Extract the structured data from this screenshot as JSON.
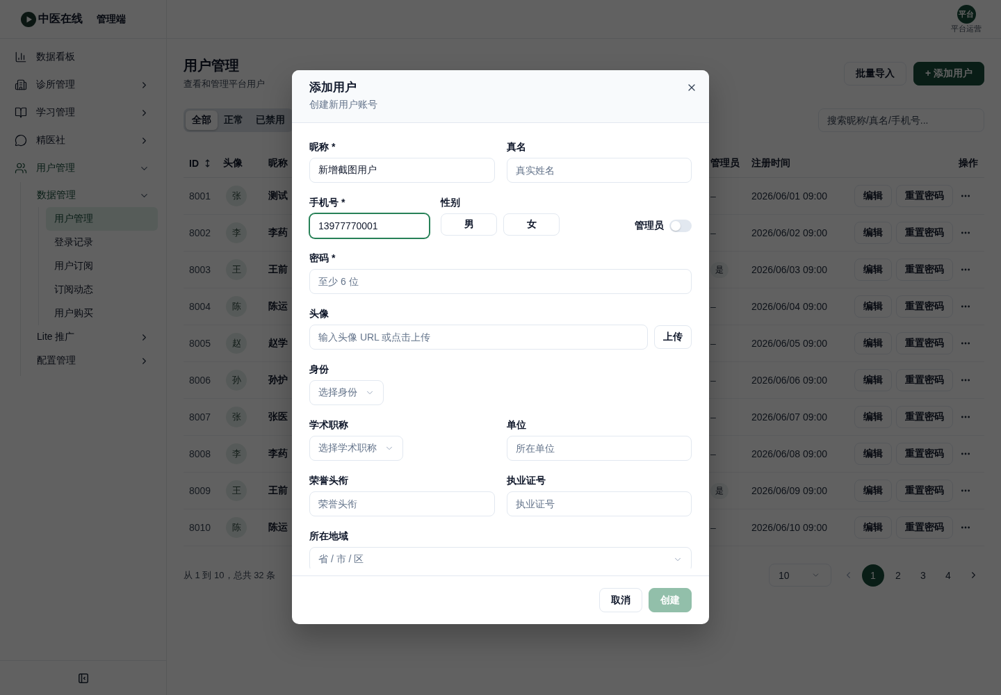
{
  "sidebar": {
    "brand": {
      "name": "中医在线",
      "tag": "管理端"
    },
    "nav": [
      {
        "kind": "link",
        "label": "数据看板",
        "selected": false
      },
      {
        "kind": "group",
        "label": "诊所管理",
        "expanded": false,
        "selected": false
      },
      {
        "kind": "group",
        "label": "学习管理",
        "expanded": false,
        "selected": false
      },
      {
        "kind": "group",
        "label": "精医社",
        "expanded": false,
        "selected": false
      },
      {
        "kind": "group",
        "label": "用户管理",
        "expanded": true,
        "selected": true,
        "children": [
          {
            "kind": "group",
            "label": "数据管理",
            "expanded": true,
            "selected": true,
            "children": [
              {
                "kind": "link",
                "label": "用户管理",
                "selected": true
              },
              {
                "kind": "link",
                "label": "登录记录",
                "selected": false
              },
              {
                "kind": "link",
                "label": "用户订阅",
                "selected": false
              },
              {
                "kind": "link",
                "label": "订阅动态",
                "selected": false
              },
              {
                "kind": "link",
                "label": "用户购买",
                "selected": false
              }
            ]
          },
          {
            "kind": "group",
            "label": "Lite 推广",
            "expanded": false,
            "selected": false
          },
          {
            "kind": "group",
            "label": "配置管理",
            "expanded": false,
            "selected": false
          }
        ]
      }
    ]
  },
  "header": {
    "user": {
      "avatar": "平台",
      "name": "平台运营"
    }
  },
  "page": {
    "title": "用户管理",
    "subtitle": "查看和管理平台用户",
    "actions": [
      {
        "kind": "secondary",
        "label": "批量导入"
      },
      {
        "kind": "primary",
        "label": "+ 添加用户"
      }
    ],
    "tabs": [
      {
        "label": "全部",
        "selected": true
      },
      {
        "label": "正常",
        "selected": false
      },
      {
        "label": "已禁用",
        "selected": false
      }
    ],
    "search": {
      "placeholder": "搜索昵称/真名/手机号..."
    },
    "table": {
      "columns": [
        {
          "kind": "sortable",
          "label": "ID"
        },
        {
          "kind": "plain",
          "label": "头像"
        },
        {
          "kind": "plain",
          "label": "昵称"
        },
        {
          "kind": "plain",
          "label": "管理员"
        },
        {
          "kind": "plain",
          "label": "注册时间"
        },
        {
          "kind": "plain",
          "label": "操作"
        }
      ],
      "rows": [
        {
          "id": "8001",
          "avatar": "张",
          "nickname": "测试",
          "admin": {
            "kind": "plain",
            "text": "–"
          },
          "registered": "2026/06/01 09:00",
          "actions": [
            "编辑",
            "重置密码"
          ]
        },
        {
          "id": "8002",
          "avatar": "李",
          "nickname": "李药",
          "admin": {
            "kind": "plain",
            "text": "–"
          },
          "registered": "2026/06/02 09:00",
          "actions": [
            "编辑",
            "重置密码"
          ]
        },
        {
          "id": "8003",
          "avatar": "王",
          "nickname": "王前",
          "admin": {
            "kind": "badge",
            "text": "是"
          },
          "registered": "2026/06/03 09:00",
          "actions": [
            "编辑",
            "重置密码"
          ]
        },
        {
          "id": "8004",
          "avatar": "陈",
          "nickname": "陈运",
          "admin": {
            "kind": "plain",
            "text": "–"
          },
          "registered": "2026/06/04 09:00",
          "actions": [
            "编辑",
            "重置密码"
          ]
        },
        {
          "id": "8005",
          "avatar": "赵",
          "nickname": "赵学",
          "admin": {
            "kind": "plain",
            "text": "–"
          },
          "registered": "2026/06/05 09:00",
          "actions": [
            "编辑",
            "重置密码"
          ]
        },
        {
          "id": "8006",
          "avatar": "孙",
          "nickname": "孙护",
          "admin": {
            "kind": "plain",
            "text": "–"
          },
          "registered": "2026/06/06 09:00",
          "actions": [
            "编辑",
            "重置密码"
          ]
        },
        {
          "id": "8007",
          "avatar": "张",
          "nickname": "张医",
          "admin": {
            "kind": "plain",
            "text": "–"
          },
          "registered": "2026/06/07 09:00",
          "actions": [
            "编辑",
            "重置密码"
          ]
        },
        {
          "id": "8008",
          "avatar": "李",
          "nickname": "李药",
          "admin": {
            "kind": "plain",
            "text": "–"
          },
          "registered": "2026/06/08 09:00",
          "actions": [
            "编辑",
            "重置密码"
          ]
        },
        {
          "id": "8009",
          "avatar": "王",
          "nickname": "王前",
          "admin": {
            "kind": "badge",
            "text": "是"
          },
          "registered": "2026/06/09 09:00",
          "actions": [
            "编辑",
            "重置密码"
          ]
        },
        {
          "id": "8010",
          "avatar": "陈",
          "nickname": "陈运",
          "admin": {
            "kind": "plain",
            "text": "–"
          },
          "registered": "2026/06/10 09:00",
          "actions": [
            "编辑",
            "重置密码"
          ]
        }
      ]
    },
    "footer": {
      "summary": "从 1 到 10，总共 32 条",
      "page_size": "10",
      "prev_disabled": true,
      "next_disabled": false,
      "pages": [
        {
          "label": "1",
          "selected": true
        },
        {
          "label": "2",
          "selected": false
        },
        {
          "label": "3",
          "selected": false
        },
        {
          "label": "4",
          "selected": false
        }
      ]
    }
  },
  "modal": {
    "title": "添加用户",
    "subtitle": "创建新用户账号",
    "rows": [
      {
        "kind": "grid",
        "fields": [
          {
            "kind": "input",
            "label": "昵称 *",
            "value": "新增截图用户",
            "focused": false
          },
          {
            "kind": "input",
            "label": "真名",
            "placeholder": "真实姓名",
            "focused": false
          }
        ]
      },
      {
        "kind": "inline",
        "fields": [
          {
            "kind": "input",
            "label": "手机号 *",
            "value": "13977770001",
            "focused": true
          },
          {
            "kind": "choice",
            "label": "性别",
            "options": [
              {
                "label": "男",
                "selected": false
              },
              {
                "label": "女",
                "selected": false
              }
            ]
          },
          {
            "kind": "switch",
            "label": "管理员",
            "on": false
          }
        ]
      },
      {
        "kind": "stack",
        "fields": [
          {
            "kind": "input",
            "label": "密码 *",
            "placeholder": "至少 6 位",
            "focused": false
          }
        ]
      },
      {
        "kind": "stack",
        "fields": [
          {
            "kind": "upload",
            "label": "头像",
            "placeholder": "输入头像 URL 或点击上传",
            "button": "上传"
          }
        ]
      },
      {
        "kind": "stack",
        "fields": [
          {
            "kind": "select",
            "label": "身份",
            "placeholder": "选择身份"
          }
        ]
      },
      {
        "kind": "grid",
        "fields": [
          {
            "kind": "select",
            "label": "学术职称",
            "placeholder": "选择学术职称"
          },
          {
            "kind": "input",
            "label": "单位",
            "placeholder": "所在单位",
            "focused": false
          }
        ]
      },
      {
        "kind": "grid",
        "fields": [
          {
            "kind": "input",
            "label": "荣誉头衔",
            "placeholder": "荣誉头衔",
            "focused": false
          },
          {
            "kind": "input",
            "label": "执业证号",
            "placeholder": "执业证号",
            "focused": false
          }
        ]
      },
      {
        "kind": "stack",
        "fields": [
          {
            "kind": "cascader",
            "label": "所在地域",
            "placeholder": "省 / 市 / 区"
          }
        ]
      }
    ],
    "buttons": [
      {
        "kind": "secondary",
        "label": "取消",
        "disabled": false
      },
      {
        "kind": "primary",
        "label": "创建",
        "disabled": true
      }
    ]
  }
}
